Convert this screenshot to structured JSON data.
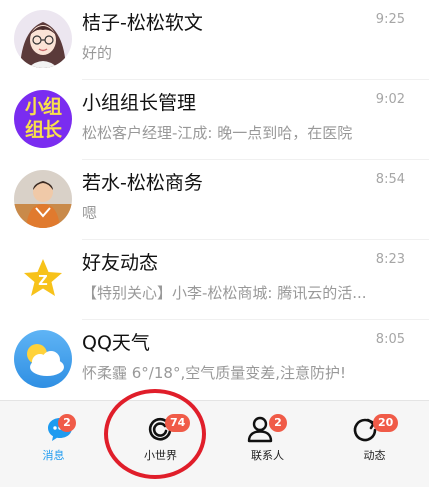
{
  "chats": [
    {
      "name": "桔子-松松软文",
      "preview": "好的",
      "time": "9:25",
      "avatar": "girl-illustration-avatar"
    },
    {
      "name": "小组组长管理",
      "preview": "松松客户经理-江成: 晚一点到哈，在医院",
      "time": "9:02",
      "avatar_text": "小组组长",
      "avatar": "group-text-avatar"
    },
    {
      "name": "若水-松松商务",
      "preview": "嗯",
      "time": "8:54",
      "avatar": "woman-photo-avatar"
    },
    {
      "name": "好友动态",
      "preview": "【特别关心】小李-松松商城: 腾讯云的活...",
      "time": "8:23",
      "avatar": "star-icon-avatar"
    },
    {
      "name": "QQ天气",
      "preview": "怀柔霾 6°/18°,空气质量变差,注意防护!",
      "time": "8:05",
      "avatar": "weather-icon-avatar"
    }
  ],
  "tabs": [
    {
      "label": "消息",
      "badge": "2",
      "icon": "message-bubble-icon",
      "active": true
    },
    {
      "label": "小世界",
      "badge": "74",
      "icon": "world-swirl-icon",
      "active": false
    },
    {
      "label": "联系人",
      "badge": "2",
      "icon": "contacts-person-icon",
      "active": false
    },
    {
      "label": "动态",
      "badge": "20",
      "icon": "refresh-circle-icon",
      "active": false
    }
  ],
  "colors": {
    "accent": "#1e9bf0",
    "badge": "#f05b48",
    "highlight_ring": "#e01e2a",
    "group_avatar_bg": "#7a2cf0",
    "star": "#f7c21a"
  }
}
